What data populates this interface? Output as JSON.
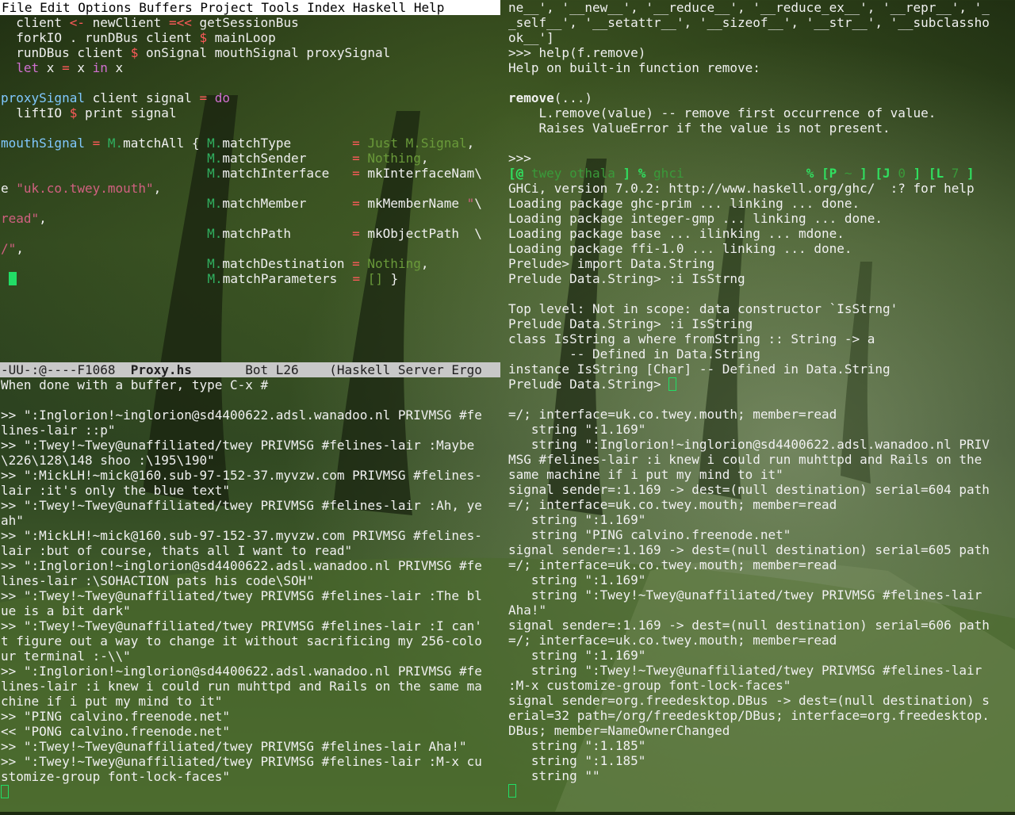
{
  "colors": {
    "keyword": "#d070d0",
    "function": "#80c8ff",
    "module": "#30b060",
    "string": "#d06080",
    "operator": "#ff5a5a",
    "constant": "#6a9a3a",
    "cursor": "#22dd66",
    "menubar_bg": "#ffffff",
    "modeline_bg": "#c8c8c8"
  },
  "menubar": {
    "items": [
      "File",
      "Edit",
      "Options",
      "Buffers",
      "Project",
      "Tools",
      "Index",
      "Haskell",
      "Help"
    ]
  },
  "editor": {
    "lines": [
      [
        {
          "t": "  client ",
          "c": "plain"
        },
        {
          "t": "<-",
          "c": "arr"
        },
        {
          "t": " newClient ",
          "c": "plain"
        },
        {
          "t": "=<<",
          "c": "arr"
        },
        {
          "t": " getSessionBus",
          "c": "plain"
        }
      ],
      [
        {
          "t": "  forkIO . runDBus client ",
          "c": "plain"
        },
        {
          "t": "$",
          "c": "arr"
        },
        {
          "t": " mainLoop",
          "c": "plain"
        }
      ],
      [
        {
          "t": "  runDBus client ",
          "c": "plain"
        },
        {
          "t": "$",
          "c": "arr"
        },
        {
          "t": " onSignal mouthSignal proxySignal",
          "c": "plain"
        }
      ],
      [
        {
          "t": "  ",
          "c": "plain"
        },
        {
          "t": "let",
          "c": "kw"
        },
        {
          "t": " x ",
          "c": "plain"
        },
        {
          "t": "=",
          "c": "arr"
        },
        {
          "t": " x ",
          "c": "plain"
        },
        {
          "t": "in",
          "c": "kw"
        },
        {
          "t": " x",
          "c": "plain"
        }
      ],
      [],
      [
        {
          "t": "proxySignal",
          "c": "fn"
        },
        {
          "t": " client signal ",
          "c": "plain"
        },
        {
          "t": "=",
          "c": "arr"
        },
        {
          "t": " ",
          "c": "plain"
        },
        {
          "t": "do",
          "c": "kw"
        }
      ],
      [
        {
          "t": "  liftIO ",
          "c": "plain"
        },
        {
          "t": "$",
          "c": "arr"
        },
        {
          "t": " print signal",
          "c": "plain"
        }
      ],
      [],
      [
        {
          "t": "mouthSignal",
          "c": "fn"
        },
        {
          "t": " ",
          "c": "plain"
        },
        {
          "t": "=",
          "c": "arr"
        },
        {
          "t": " ",
          "c": "plain"
        },
        {
          "t": "M.",
          "c": "mod"
        },
        {
          "t": "matchAll { ",
          "c": "plain"
        },
        {
          "t": "M.",
          "c": "mod"
        },
        {
          "t": "matchType        ",
          "c": "plain"
        },
        {
          "t": "=",
          "c": "arr"
        },
        {
          "t": " ",
          "c": "plain"
        },
        {
          "t": "Just M.Signal",
          "c": "con"
        },
        {
          "t": ",",
          "c": "plain"
        }
      ],
      [
        {
          "t": "                           ",
          "c": "plain"
        },
        {
          "t": "M.",
          "c": "mod"
        },
        {
          "t": "matchSender      ",
          "c": "plain"
        },
        {
          "t": "=",
          "c": "arr"
        },
        {
          "t": " ",
          "c": "plain"
        },
        {
          "t": "Nothing",
          "c": "con"
        },
        {
          "t": ",",
          "c": "plain"
        }
      ],
      [
        {
          "t": "                           ",
          "c": "plain"
        },
        {
          "t": "M.",
          "c": "mod"
        },
        {
          "t": "matchInterface   ",
          "c": "plain"
        },
        {
          "t": "=",
          "c": "arr"
        },
        {
          "t": " mkInterfaceNam\\",
          "c": "plain"
        }
      ],
      [
        {
          "t": "e ",
          "c": "plain"
        },
        {
          "t": "\"uk.co.twey.mouth\"",
          "c": "str"
        },
        {
          "t": ",",
          "c": "plain"
        }
      ],
      [
        {
          "t": "                           ",
          "c": "plain"
        },
        {
          "t": "M.",
          "c": "mod"
        },
        {
          "t": "matchMember      ",
          "c": "plain"
        },
        {
          "t": "=",
          "c": "arr"
        },
        {
          "t": " mkMemberName ",
          "c": "plain"
        },
        {
          "t": "\"",
          "c": "str"
        },
        {
          "t": "\\",
          "c": "plain"
        }
      ],
      [
        {
          "t": "read\"",
          "c": "str"
        },
        {
          "t": ",",
          "c": "plain"
        }
      ],
      [
        {
          "t": "                           ",
          "c": "plain"
        },
        {
          "t": "M.",
          "c": "mod"
        },
        {
          "t": "matchPath        ",
          "c": "plain"
        },
        {
          "t": "=",
          "c": "arr"
        },
        {
          "t": " mkObjectPath  \\",
          "c": "plain"
        }
      ],
      [
        {
          "t": "/\"",
          "c": "str"
        },
        {
          "t": ",",
          "c": "plain"
        }
      ],
      [
        {
          "t": "                           ",
          "c": "plain"
        },
        {
          "t": "M.",
          "c": "mod"
        },
        {
          "t": "matchDestination ",
          "c": "plain"
        },
        {
          "t": "=",
          "c": "arr"
        },
        {
          "t": " ",
          "c": "plain"
        },
        {
          "t": "Nothing",
          "c": "con"
        },
        {
          "t": ",",
          "c": "plain"
        }
      ],
      [
        {
          "t": " ",
          "c": "plain"
        },
        {
          "cursor": true
        },
        {
          "t": "                         ",
          "c": "plain"
        },
        {
          "t": "M.",
          "c": "mod"
        },
        {
          "t": "matchParameters  ",
          "c": "plain"
        },
        {
          "t": "=",
          "c": "arr"
        },
        {
          "t": " ",
          "c": "plain"
        },
        {
          "t": "[]",
          "c": "con"
        },
        {
          "t": " }",
          "c": "plain"
        }
      ]
    ]
  },
  "modeline": {
    "status": "-UU-:@----F1068  ",
    "buffer": "Proxy.hs",
    "position": "       Bot L26    ",
    "mode": "(Haskell Server Ergo"
  },
  "irc_log": {
    "lines": [
      "When done with a buffer, type C-x #",
      "",
      ">> \":Inglorion!~inglorion@sd4400622.adsl.wanadoo.nl PRIVMSG #fe",
      "lines-lair ::p\"",
      ">> \":Twey!~Twey@unaffiliated/twey PRIVMSG #felines-lair :Maybe ",
      "\\226\\128\\148 shoo :\\195\\190\"",
      ">> \":MickLH!~mick@160.sub-97-152-37.myvzw.com PRIVMSG #felines-",
      "lair :it's only the blue text\"",
      ">> \":Twey!~Twey@unaffiliated/twey PRIVMSG #felines-lair :Ah, ye",
      "ah\"",
      ">> \":MickLH!~mick@160.sub-97-152-37.myvzw.com PRIVMSG #felines-",
      "lair :but of course, thats all I want to read\"",
      ">> \":Inglorion!~inglorion@sd4400622.adsl.wanadoo.nl PRIVMSG #fe",
      "lines-lair :\\SOHACTION pats his code\\SOH\"",
      ">> \":Twey!~Twey@unaffiliated/twey PRIVMSG #felines-lair :The bl",
      "ue is a bit dark\"",
      ">> \":Twey!~Twey@unaffiliated/twey PRIVMSG #felines-lair :I can'",
      "t figure out a way to change it without sacrificing my 256-colo",
      "ur terminal :-\\\\\"",
      ">> \":Inglorion!~inglorion@sd4400622.adsl.wanadoo.nl PRIVMSG #fe",
      "lines-lair :i knew i could run muhttpd and Rails on the same ma",
      "chine if i put my mind to it\"",
      ">> \"PING calvino.freenode.net\"",
      "<< \"PONG calvino.freenode.net\"",
      ">> \":Twey!~Twey@unaffiliated/twey PRIVMSG #felines-lair Aha!\"",
      ">> \":Twey!~Twey@unaffiliated/twey PRIVMSG #felines-lair :M-x cu",
      "stomize-group font-lock-faces\""
    ]
  },
  "python_term": {
    "lines": [
      [
        {
          "t": "ne__', '__new__', '__reduce__', '__reduce_ex__', '__repr__', '_"
        }
      ],
      [
        {
          "t": "_self__', '__setattr__', '__sizeof__', '__str__', '__subclassho"
        }
      ],
      [
        {
          "t": "ok__']"
        }
      ],
      [
        {
          "t": ">>> help(f.remove)"
        }
      ],
      [
        {
          "t": "Help on built-in function remove:"
        }
      ],
      [],
      [
        {
          "t": "remove",
          "c": "bold"
        },
        {
          "t": "(...)"
        }
      ],
      [
        {
          "t": "    L.remove(value) -- remove first occurrence of value."
        }
      ],
      [
        {
          "t": "    Raises ValueError if the value is not present."
        }
      ],
      [],
      [
        {
          "t": ">>>"
        }
      ],
      [
        {
          "t": "[@ ",
          "c": "pg"
        },
        {
          "t": "twey",
          "c": "pd"
        },
        {
          "t": " ",
          "c": "pg"
        },
        {
          "t": "othala",
          "c": "pd"
        },
        {
          "t": " ] % ",
          "c": "pg"
        },
        {
          "t": "ghci",
          "c": "pd"
        },
        {
          "t": "                % ",
          "c": "pg"
        },
        {
          "t": "[P ",
          "c": "pg"
        },
        {
          "t": "~",
          "c": "pd"
        },
        {
          "t": " ] [J ",
          "c": "pg"
        },
        {
          "t": "0",
          "c": "pd"
        },
        {
          "t": " ] [L ",
          "c": "pg"
        },
        {
          "t": "7",
          "c": "pd"
        },
        {
          "t": " ]",
          "c": "pg"
        }
      ],
      [
        {
          "t": "GHCi, version 7.0.2: http://www.haskell.org/ghc/  :? for help"
        }
      ],
      [
        {
          "t": "Loading package ghc-prim ... linking ... done."
        }
      ],
      [
        {
          "t": "Loading package integer-gmp ... linking ... done."
        }
      ],
      [
        {
          "t": "Loading package base ... ilinking ... mdone."
        }
      ],
      [
        {
          "t": "Loading package ffi-1.0 ... linking ... done."
        }
      ],
      [
        {
          "t": "Prelude> import Data.String"
        }
      ],
      [
        {
          "t": "Prelude Data.String> :i IsStrng"
        }
      ],
      [],
      [
        {
          "t": "Top level: Not in scope: data constructor `IsStrng'"
        }
      ],
      [
        {
          "t": "Prelude Data.String> :i IsString"
        }
      ],
      [
        {
          "t": "class IsString a where fromString :: String -> a"
        }
      ],
      [
        {
          "t": "        -- Defined in Data.String"
        }
      ],
      [
        {
          "t": "instance IsString [Char] -- Defined in Data.String"
        }
      ],
      [
        {
          "t": "Prelude Data.String> "
        },
        {
          "hcursor": true
        }
      ]
    ]
  },
  "dbus_log": {
    "lines": [
      "=/; interface=uk.co.twey.mouth; member=read",
      "   string \":1.169\"",
      "   string \":Inglorion!~inglorion@sd4400622.adsl.wanadoo.nl PRIV",
      "MSG #felines-lair :i knew i could run muhttpd and Rails on the",
      "same machine if i put my mind to it\"",
      "signal sender=:1.169 -> dest=(null destination) serial=604 path",
      "=/; interface=uk.co.twey.mouth; member=read",
      "   string \":1.169\"",
      "   string \"PING calvino.freenode.net\"",
      "signal sender=:1.169 -> dest=(null destination) serial=605 path",
      "=/; interface=uk.co.twey.mouth; member=read",
      "   string \":1.169\"",
      "   string \":Twey!~Twey@unaffiliated/twey PRIVMSG #felines-lair",
      "Aha!\"",
      "signal sender=:1.169 -> dest=(null destination) serial=606 path",
      "=/; interface=uk.co.twey.mouth; member=read",
      "   string \":1.169\"",
      "   string \":Twey!~Twey@unaffiliated/twey PRIVMSG #felines-lair",
      ":M-x customize-group font-lock-faces\"",
      "signal sender=org.freedesktop.DBus -> dest=(null destination) s",
      "erial=32 path=/org/freedesktop/DBus; interface=org.freedesktop.",
      "DBus; member=NameOwnerChanged",
      "   string \":1.185\"",
      "   string \":1.185\"",
      "   string \"\""
    ]
  }
}
